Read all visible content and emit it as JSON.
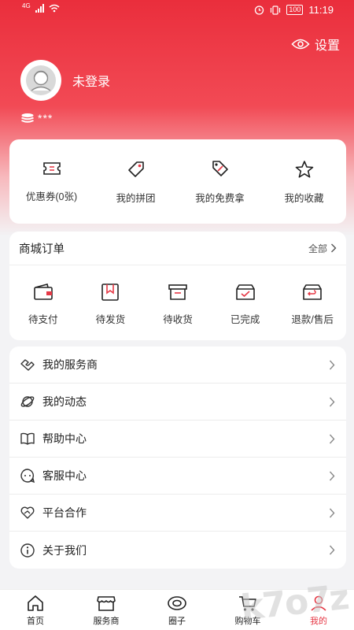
{
  "status_bar": {
    "network": "4G",
    "battery": "100",
    "time": "11:19"
  },
  "header": {
    "settings_label": "设置",
    "username": "未登录",
    "points": "***"
  },
  "quick_actions": [
    {
      "label": "优惠券(0张)",
      "icon": "coupon-icon"
    },
    {
      "label": "我的拼团",
      "icon": "tag-icon"
    },
    {
      "label": "我的免费拿",
      "icon": "free-tag-icon"
    },
    {
      "label": "我的收藏",
      "icon": "star-icon"
    }
  ],
  "orders": {
    "title": "商城订单",
    "all_label": "全部",
    "items": [
      {
        "label": "待支付",
        "icon": "wallet-icon"
      },
      {
        "label": "待发货",
        "icon": "package-icon"
      },
      {
        "label": "待收货",
        "icon": "receive-box-icon"
      },
      {
        "label": "已完成",
        "icon": "completed-box-icon"
      },
      {
        "label": "退款/售后",
        "icon": "refund-box-icon"
      }
    ]
  },
  "menu": [
    {
      "label": "我的服务商",
      "icon": "handshake-icon"
    },
    {
      "label": "我的动态",
      "icon": "planet-icon"
    },
    {
      "label": "帮助中心",
      "icon": "book-icon"
    },
    {
      "label": "客服中心",
      "icon": "chat-icon"
    },
    {
      "label": "平台合作",
      "icon": "heart-hands-icon"
    },
    {
      "label": "关于我们",
      "icon": "info-icon"
    }
  ],
  "tabbar": [
    {
      "label": "首页",
      "icon": "home-icon"
    },
    {
      "label": "服务商",
      "icon": "store-icon"
    },
    {
      "label": "圈子",
      "icon": "circle-icon"
    },
    {
      "label": "购物车",
      "icon": "cart-icon"
    },
    {
      "label": "我的",
      "icon": "profile-icon",
      "active": true
    }
  ],
  "watermark": "k7o7z",
  "colors": {
    "brand": "#e63946",
    "header_top": "#ea2e3c"
  }
}
